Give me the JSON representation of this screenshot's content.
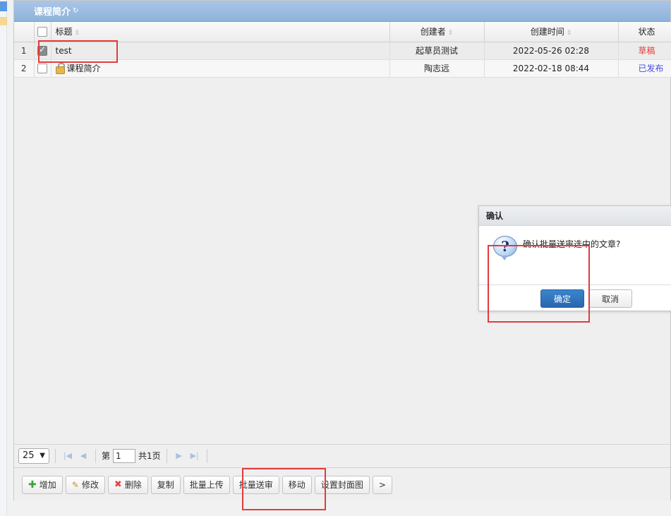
{
  "panel": {
    "title": "课程简介",
    "refresh_glyph": "↻"
  },
  "grid": {
    "columns": {
      "title": "标题",
      "creator": "创建者",
      "created_time": "创建时间",
      "status": "状态"
    },
    "sort_glyph": "⇕",
    "rows": [
      {
        "num": "1",
        "checked": true,
        "title": "test",
        "locked": false,
        "creator": "起草员测试",
        "created_time": "2022-05-26 02:28",
        "status": "草稿",
        "status_color": "#e0403a"
      },
      {
        "num": "2",
        "checked": false,
        "title": "课程简介",
        "locked": true,
        "creator": "陶志远",
        "created_time": "2022-02-18 08:44",
        "status": "已发布",
        "status_color": "#4a4ae0"
      }
    ]
  },
  "pager": {
    "page_size": "25",
    "page_label_prefix": "第",
    "current_page": "1",
    "total_pages_label": "共1页",
    "nav_glyphs": {
      "first": "|◀",
      "prev": "◀",
      "next": "▶",
      "last": "▶|"
    }
  },
  "toolbar": {
    "add": "增加",
    "edit": "修改",
    "delete": "删除",
    "copy": "复制",
    "batch_upload": "批量上传",
    "batch_submit": "批量送审",
    "move": "移动",
    "set_cover": "设置封面图",
    "more": ">"
  },
  "dialog": {
    "title": "确认",
    "message": "确认批量送审选中的文章?",
    "ok_label": "确定",
    "cancel_label": "取消"
  },
  "colors": {
    "accent": "#2866ad",
    "highlight": "#e23b3b",
    "header": "#9bbde0"
  }
}
